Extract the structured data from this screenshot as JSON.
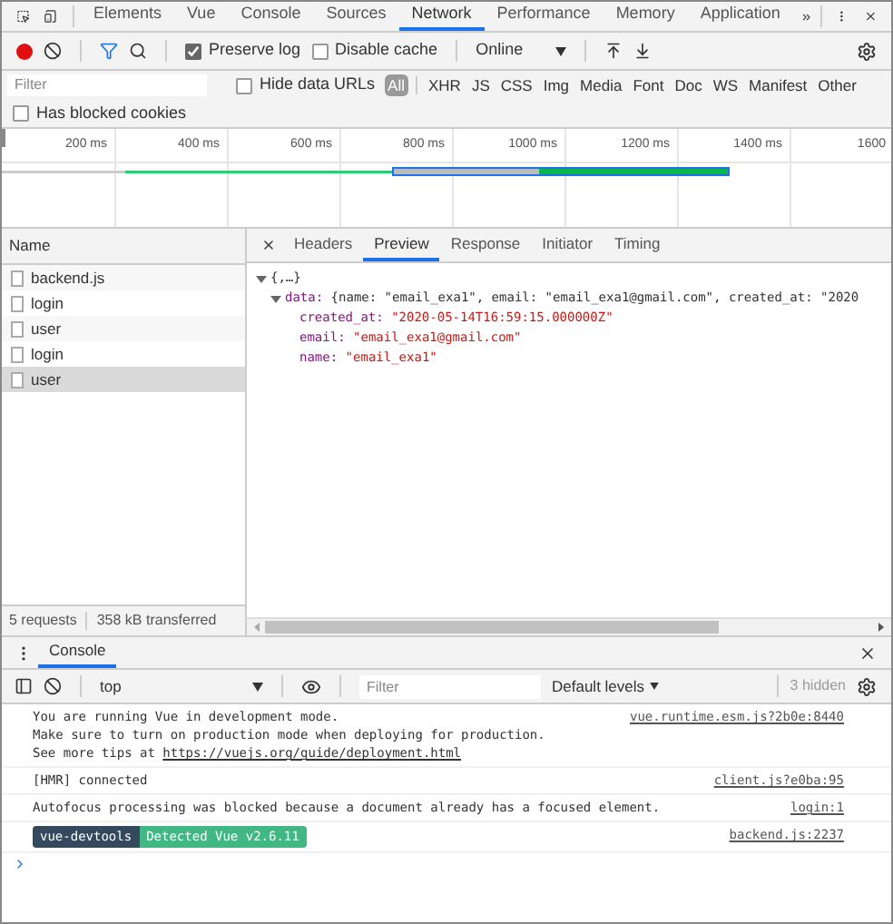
{
  "main_tabs": [
    {
      "label": "Elements",
      "selected": false
    },
    {
      "label": "Vue",
      "selected": false
    },
    {
      "label": "Console",
      "selected": false
    },
    {
      "label": "Sources",
      "selected": false
    },
    {
      "label": "Network",
      "selected": true
    },
    {
      "label": "Performance",
      "selected": false
    },
    {
      "label": "Memory",
      "selected": false
    },
    {
      "label": "Application",
      "selected": false
    }
  ],
  "toolbar": {
    "recording": true,
    "preserve_log": {
      "label": "Preserve log",
      "checked": true
    },
    "disable_cache": {
      "label": "Disable cache",
      "checked": false
    },
    "throttling": "Online"
  },
  "filter": {
    "placeholder": "Filter",
    "hide_data_urls": {
      "label": "Hide data URLs",
      "checked": false
    },
    "types": [
      {
        "label": "All",
        "selected": true
      },
      {
        "label": "XHR",
        "selected": false
      },
      {
        "label": "JS",
        "selected": false
      },
      {
        "label": "CSS",
        "selected": false
      },
      {
        "label": "Img",
        "selected": false
      },
      {
        "label": "Media",
        "selected": false
      },
      {
        "label": "Font",
        "selected": false
      },
      {
        "label": "Doc",
        "selected": false
      },
      {
        "label": "WS",
        "selected": false
      },
      {
        "label": "Manifest",
        "selected": false
      },
      {
        "label": "Other",
        "selected": false
      }
    ],
    "has_blocked_cookies": {
      "label": "Has blocked cookies",
      "checked": false
    }
  },
  "timeline": {
    "ticks": [
      "200 ms",
      "400 ms",
      "600 ms",
      "800 ms",
      "1000 ms",
      "1200 ms",
      "1400 ms",
      "1600"
    ]
  },
  "requests": {
    "column": "Name",
    "rows": [
      {
        "name": "backend.js",
        "selected": false
      },
      {
        "name": "login",
        "selected": false
      },
      {
        "name": "user",
        "selected": false
      },
      {
        "name": "login",
        "selected": false
      },
      {
        "name": "user",
        "selected": true
      }
    ],
    "summary": [
      "5 requests",
      "358 kB transferred"
    ]
  },
  "detail_tabs": [
    {
      "label": "Headers",
      "selected": false
    },
    {
      "label": "Preview",
      "selected": true
    },
    {
      "label": "Response",
      "selected": false
    },
    {
      "label": "Initiator",
      "selected": false
    },
    {
      "label": "Timing",
      "selected": false
    }
  ],
  "preview": {
    "root": "{,…}",
    "expanded": true,
    "data": {
      "key": "data:",
      "summary": "{name: \"email_exa1\", email: \"email_exa1@gmail.com\", created_at: \"2020",
      "expanded": true,
      "fields": [
        {
          "key": "created_at:",
          "value": "\"2020-05-14T16:59:15.000000Z\""
        },
        {
          "key": "email:",
          "value": "\"email_exa1@gmail.com\""
        },
        {
          "key": "name:",
          "value": "\"email_exa1\""
        }
      ]
    }
  },
  "drawer": {
    "tab": "Console",
    "context": "top",
    "filter_placeholder": "Filter",
    "levels": "Default levels",
    "hidden": "3 hidden",
    "messages": [
      {
        "kind": "text",
        "lines": [
          "You are running Vue in development mode.",
          "Make sure to turn on production mode when deploying for production.",
          "See more tips at"
        ],
        "link": "https://vuejs.org/guide/deployment.html",
        "source": "vue.runtime.esm.js?2b0e:8440"
      },
      {
        "kind": "text",
        "lines": [
          "[HMR] connected"
        ],
        "source": "client.js?e0ba:95"
      },
      {
        "kind": "text",
        "lines": [
          "Autofocus processing was blocked because a document already has a focused element."
        ],
        "source": "login:1"
      },
      {
        "kind": "badges",
        "badges": [
          {
            "label": "vue-devtools",
            "color": "#35495e"
          },
          {
            "label": "Detected Vue v2.6.11",
            "color": "#41b883"
          }
        ],
        "source": "backend.js:2237"
      }
    ]
  }
}
